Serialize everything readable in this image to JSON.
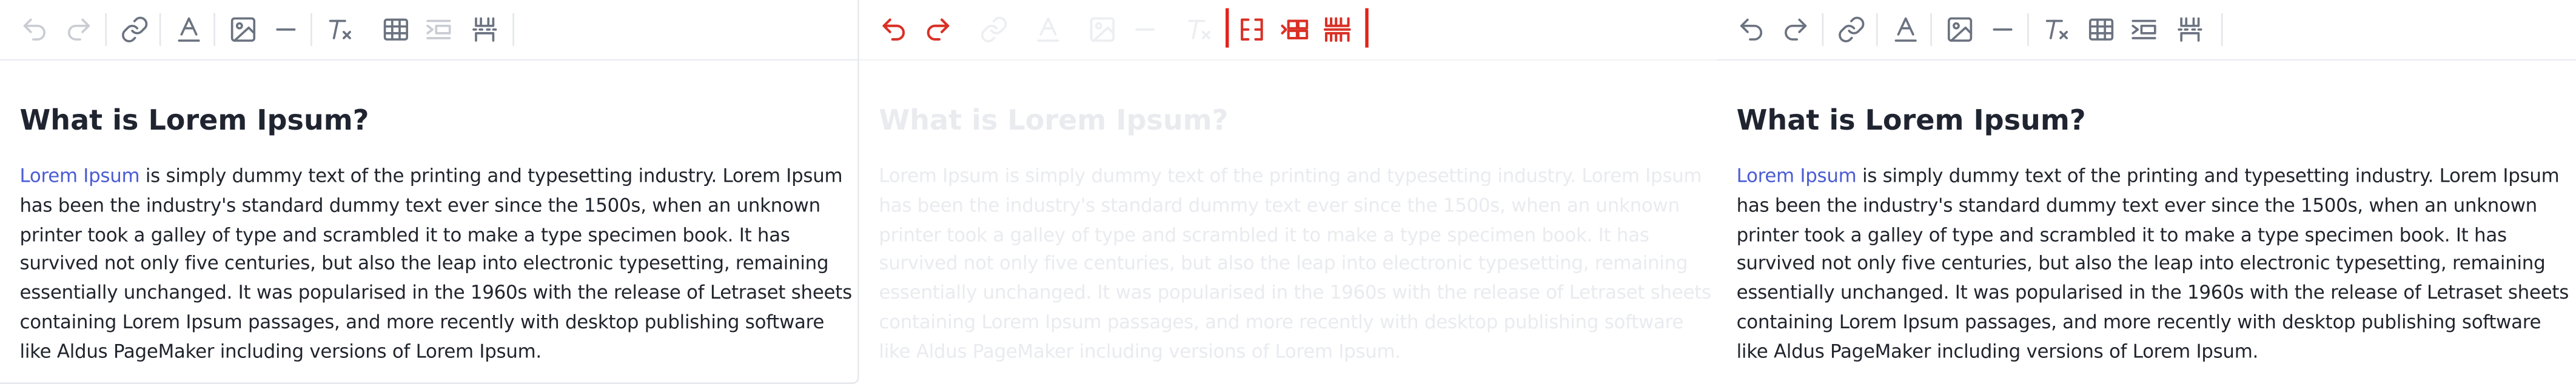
{
  "toolbar": {
    "buttons": [
      {
        "name": "undo",
        "icon": "undo-icon"
      },
      {
        "name": "redo",
        "icon": "redo-icon"
      },
      {
        "name": "link",
        "icon": "link-icon"
      },
      {
        "name": "text-color",
        "icon": "text-color-icon"
      },
      {
        "name": "image",
        "icon": "image-icon"
      },
      {
        "name": "horizontal-rule",
        "icon": "horizontal-rule-icon"
      },
      {
        "name": "clear-format",
        "icon": "clear-format-icon"
      },
      {
        "name": "table",
        "icon": "table-icon"
      },
      {
        "name": "indent",
        "icon": "indent-icon"
      },
      {
        "name": "page-break",
        "icon": "page-break-icon"
      }
    ],
    "active_color": "#d93025",
    "icon_color": "#6b7280",
    "disabled_color": "#c9ccd2"
  },
  "document": {
    "heading": "What is Lorem Ipsum?",
    "link_text": "Lorem Ipsum",
    "line1_rest": " is simply dummy text of the printing and typesetting industry. Lorem Ipsum",
    "lines": [
      "has been the industry's standard dummy text ever since the 1500s, when an unknown",
      "printer took a galley of type and scrambled it to make a type specimen book. It has",
      "survived not only five centuries, but also the leap into electronic typesetting, remaining",
      "essentially unchanged. It was popularised in the 1960s with the release of Letraset sheets",
      "containing Lorem Ipsum passages, and more recently with desktop publishing software",
      "like Aldus PageMaker including versions of Lorem Ipsum."
    ],
    "link_color": "#4a5bd4"
  }
}
